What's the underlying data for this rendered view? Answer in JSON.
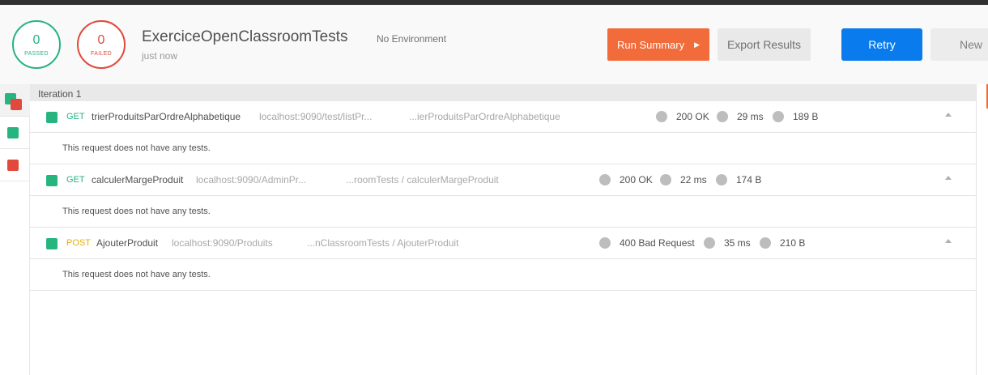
{
  "summary": {
    "passed_count": "0",
    "passed_label": "PASSED",
    "failed_count": "0",
    "failed_label": "FAILED"
  },
  "collection": {
    "title": "ExerciceOpenClassroomTests",
    "environment": "No Environment",
    "time": "just now"
  },
  "buttons": {
    "run_summary": "Run Summary",
    "run_summary_arrow": "▶",
    "export": "Export Results",
    "retry": "Retry",
    "new": "New"
  },
  "iteration": {
    "label": "Iteration 1"
  },
  "requests": [
    {
      "method": "GET",
      "name": "trierProduitsParOrdreAlphabetique",
      "url": "localhost:9090/test/listPr...",
      "path": "...ierProduitsParOrdreAlphabetique",
      "status": "200 OK",
      "time": "29 ms",
      "size": "189 B",
      "note": "This request does not have any tests."
    },
    {
      "method": "GET",
      "name": "calculerMargeProduit",
      "url": "localhost:9090/AdminPr...",
      "path": "...roomTests / calculerMargeProduit",
      "status": "200 OK",
      "time": "22 ms",
      "size": "174 B",
      "note": "This request does not have any tests."
    },
    {
      "method": "POST",
      "name": "AjouterProduit",
      "url": "localhost:9090/Produits",
      "path": "...nClassroomTests / AjouterProduit",
      "status": "400 Bad Request",
      "time": "35 ms",
      "size": "210 B",
      "note": "This request does not have any tests."
    }
  ],
  "colors": {
    "passed": "#26b47f",
    "failed": "#e2483b",
    "run_summary": "#f26b3a",
    "retry": "#097bed",
    "post": "#e6b000"
  }
}
